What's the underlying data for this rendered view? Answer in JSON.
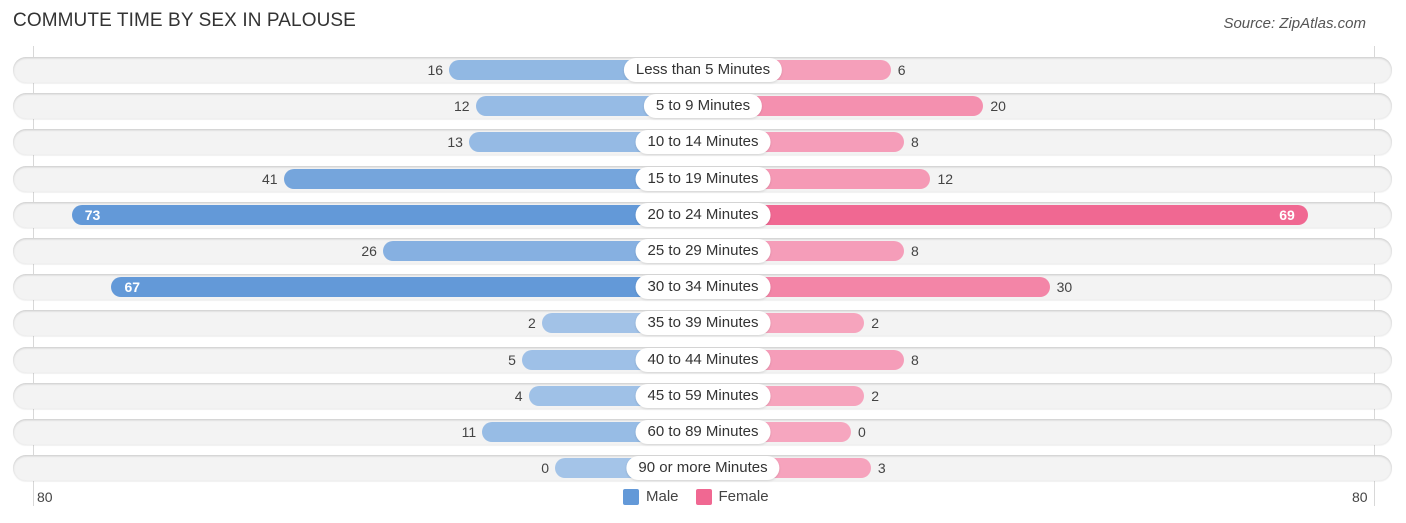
{
  "header": {
    "title": "COMMUTE TIME BY SEX IN PALOUSE",
    "source": "Source: ZipAtlas.com"
  },
  "colors": {
    "male_strong": "#6399d8",
    "male_light": "#a4c4e8",
    "female_strong": "#f06892",
    "female_light": "#f6a6bf"
  },
  "chart_data": {
    "type": "bar",
    "orientation": "horizontal-diverging",
    "title": "COMMUTE TIME BY SEX IN PALOUSE",
    "categories": [
      "Less than 5 Minutes",
      "5 to 9 Minutes",
      "10 to 14 Minutes",
      "15 to 19 Minutes",
      "20 to 24 Minutes",
      "25 to 29 Minutes",
      "30 to 34 Minutes",
      "35 to 39 Minutes",
      "40 to 44 Minutes",
      "45 to 59 Minutes",
      "60 to 89 Minutes",
      "90 or more Minutes"
    ],
    "series": [
      {
        "name": "Male",
        "values": [
          16,
          12,
          13,
          41,
          73,
          26,
          67,
          2,
          5,
          4,
          11,
          0
        ]
      },
      {
        "name": "Female",
        "values": [
          6,
          20,
          8,
          12,
          69,
          8,
          30,
          2,
          8,
          2,
          0,
          3
        ]
      }
    ],
    "xlim": [
      -80,
      80
    ],
    "axis_tick_labels": {
      "left": "80",
      "right": "80"
    },
    "legend": {
      "position": "bottom-center",
      "entries": [
        "Male",
        "Female"
      ]
    },
    "xlabel": "",
    "ylabel": ""
  }
}
